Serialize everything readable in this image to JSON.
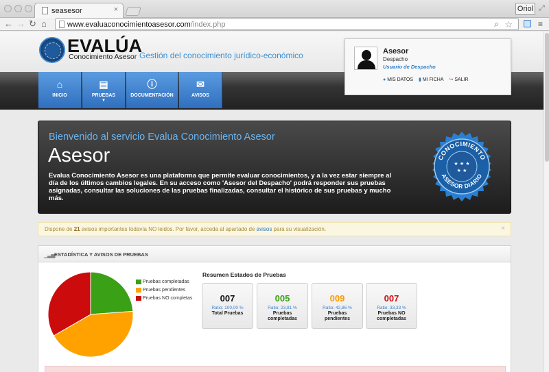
{
  "browser": {
    "tab_title": "seasesor",
    "tab_close": "×",
    "user_button": "Oriol",
    "url_host": "www.evaluaconocimientoasesor.com",
    "url_path": "/index.php",
    "back": "←",
    "forward": "→",
    "reload": "↻",
    "home": "⌂",
    "zoom_icon": "⌕",
    "star_icon": "☆",
    "menu_icon": "≡",
    "restore_icon": "⤢"
  },
  "header": {
    "logo_title": "EVALÚA",
    "logo_subtitle": "Conocimiento Asesor",
    "tagline": "Gestión del conocimiento jurídico-económico"
  },
  "nav": {
    "items": [
      {
        "label": "INICIO",
        "icon": "home-icon",
        "glyph": "⌂"
      },
      {
        "label": "PRUEBAS",
        "icon": "folder-icon",
        "glyph": "▤",
        "caret": "▼"
      },
      {
        "label": "DOCUMENTACIÓN",
        "icon": "info-icon",
        "glyph": "ⓘ"
      },
      {
        "label": "AVISOS",
        "icon": "chat-icon",
        "glyph": "✉"
      }
    ]
  },
  "user": {
    "name": "Asesor",
    "org": "Despacho",
    "role": "Usuario de Despacho",
    "links": {
      "profile": "MIS DATOS",
      "sheet": "MI FICHA",
      "logout": "SALIR"
    }
  },
  "hero": {
    "welcome": "Bienvenido al servicio Evalua Conocimiento Asesor",
    "title": "Asesor",
    "text": "Evalua Conocimiento Asesor es una plataforma que permite evaluar conocimientos, y a la vez estar siempre al día de los últimos cambios legales. En su acceso como 'Asesor del Despacho' podrá responder sus pruebas asignadas, consultar las soluciones de las pruebas finalizadas, consultar el histórico de sus pruebas y mucho más.",
    "seal_top": "CONOCIMIENTO",
    "seal_bottom": "ASESOR DIARIO"
  },
  "alert": {
    "prefix": "Dispone de ",
    "count": "21",
    "middle": " avisos importantes todavía NO leidos. Por favor, acceda al apartado de ",
    "link": "avisos",
    "suffix": " para su visualización.",
    "close": "×"
  },
  "panel": {
    "title": "ESTADÍSTICA Y AVISOS DE PRUEBAS",
    "summary_title": "Resumen Estados de Pruebas"
  },
  "chart_data": {
    "type": "pie",
    "series": [
      {
        "name": "Pruebas completadas",
        "value": 5,
        "percent": 23.81,
        "color": "#3aa015"
      },
      {
        "name": "Pruebas pendientes",
        "value": 9,
        "percent": 42.86,
        "color": "#ffa200"
      },
      {
        "name": "Pruebas NO completas",
        "value": 7,
        "percent": 33.33,
        "color": "#cc0c0c"
      }
    ]
  },
  "stats": [
    {
      "number": "007",
      "ratio": "Ratio: 100,00 %",
      "label": "Total Pruebas",
      "color": "#111111"
    },
    {
      "number": "005",
      "ratio": "Ratio: 23,81 %",
      "label": "Pruebas completadas",
      "color": "#3aa015"
    },
    {
      "number": "009",
      "ratio": "Ratio: 42,86 %",
      "label": "Pruebas pendientes",
      "color": "#ff9900"
    },
    {
      "number": "007",
      "ratio": "Ratio: 33,33 %",
      "label": "Pruebas NO completadas",
      "color": "#cc1111"
    }
  ]
}
